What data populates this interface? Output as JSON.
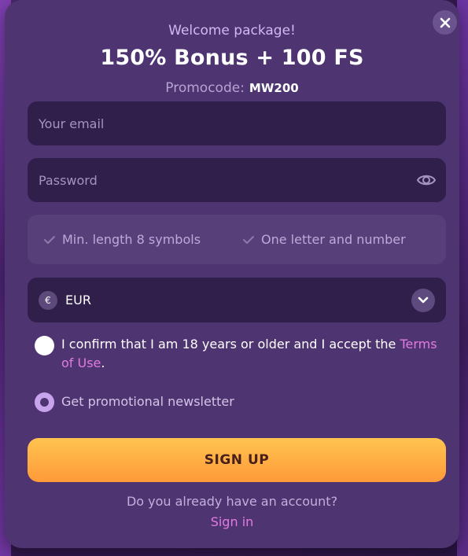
{
  "modal": {
    "welcome": "Welcome package!",
    "headline": "150% Bonus + 100 FS",
    "promo_label": "Promocode:",
    "promo_code": "MW200"
  },
  "form": {
    "email_placeholder": "Your email",
    "password_placeholder": "Password",
    "requirements": [
      "Min. length 8 symbols",
      "One letter and number"
    ],
    "currency_symbol": "€",
    "currency_value": "EUR",
    "terms_text": "I confirm that I am 18 years or older and I accept the ",
    "terms_link": "Terms of Use",
    "terms_suffix": ".",
    "newsletter_label": "Get promotional newsletter",
    "signup_label": "SIGN UP",
    "account_question": "Do you already have an account?",
    "signin_link": "Sign in"
  },
  "colors": {
    "accent_link": "#e37be0",
    "button_gradient_top": "#ffc44f",
    "button_gradient_bottom": "#ff9a3a",
    "modal_bg": "#4e3470"
  },
  "icons": {
    "close": "close-icon",
    "eye": "eye-icon",
    "check": "check-icon",
    "chevron": "chevron-down-icon"
  }
}
